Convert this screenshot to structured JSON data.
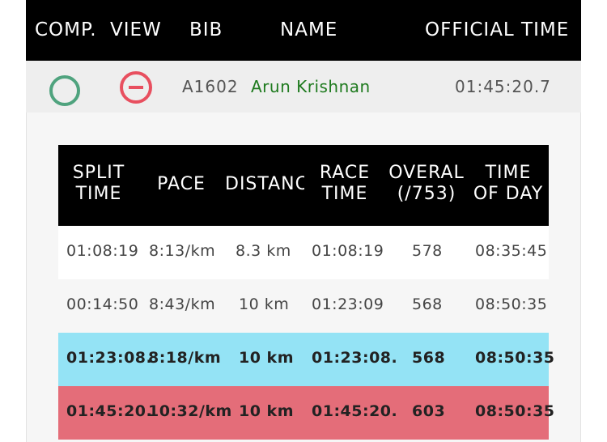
{
  "header": {
    "comp": "COMP.",
    "view": "VIEW",
    "bib": "BIB",
    "name": "NAME",
    "official_time": "OFFICIAL TIME"
  },
  "result": {
    "bib": "A1602",
    "name": "Arun Krishnan",
    "official_time": "01:45:20.7"
  },
  "split_table": {
    "headers": {
      "split_time": "SPLIT\nTIME",
      "pace": "PACE",
      "distance": "DISTANC",
      "race_time": "RACE\nTIME",
      "overall": "OVERAL\n(/753)",
      "time_of_day": "TIME\nOF DAY"
    },
    "rows": [
      {
        "split_time": "01:08:19",
        "pace": "8:13/km",
        "distance": "8.3 km",
        "race_time": "01:08:19",
        "overall": "578",
        "time_of_day": "08:35:45"
      },
      {
        "split_time": "00:14:50",
        "pace": "8:43/km",
        "distance": "10 km",
        "race_time": "01:23:09",
        "overall": "568",
        "time_of_day": "08:50:35"
      },
      {
        "split_time": "01:23:08.",
        "pace": "8:18/km",
        "distance": "10 km",
        "race_time": "01:23:08.",
        "overall": "568",
        "time_of_day": "08:50:35"
      },
      {
        "split_time": "01:45:20.",
        "pace": "10:32/km",
        "distance": "10 km",
        "race_time": "01:45:20.",
        "overall": "603",
        "time_of_day": "08:50:35"
      }
    ]
  },
  "colors": {
    "header_bg": "#000000",
    "name_green": "#1e7a1e",
    "comp_circle": "#4fa37e",
    "view_red": "#e84f5f",
    "highlight_blue": "#94e3f5",
    "highlight_red": "#e46d79"
  },
  "icons": {
    "comp": "circle-outline-icon",
    "view": "minus-circle-icon"
  }
}
